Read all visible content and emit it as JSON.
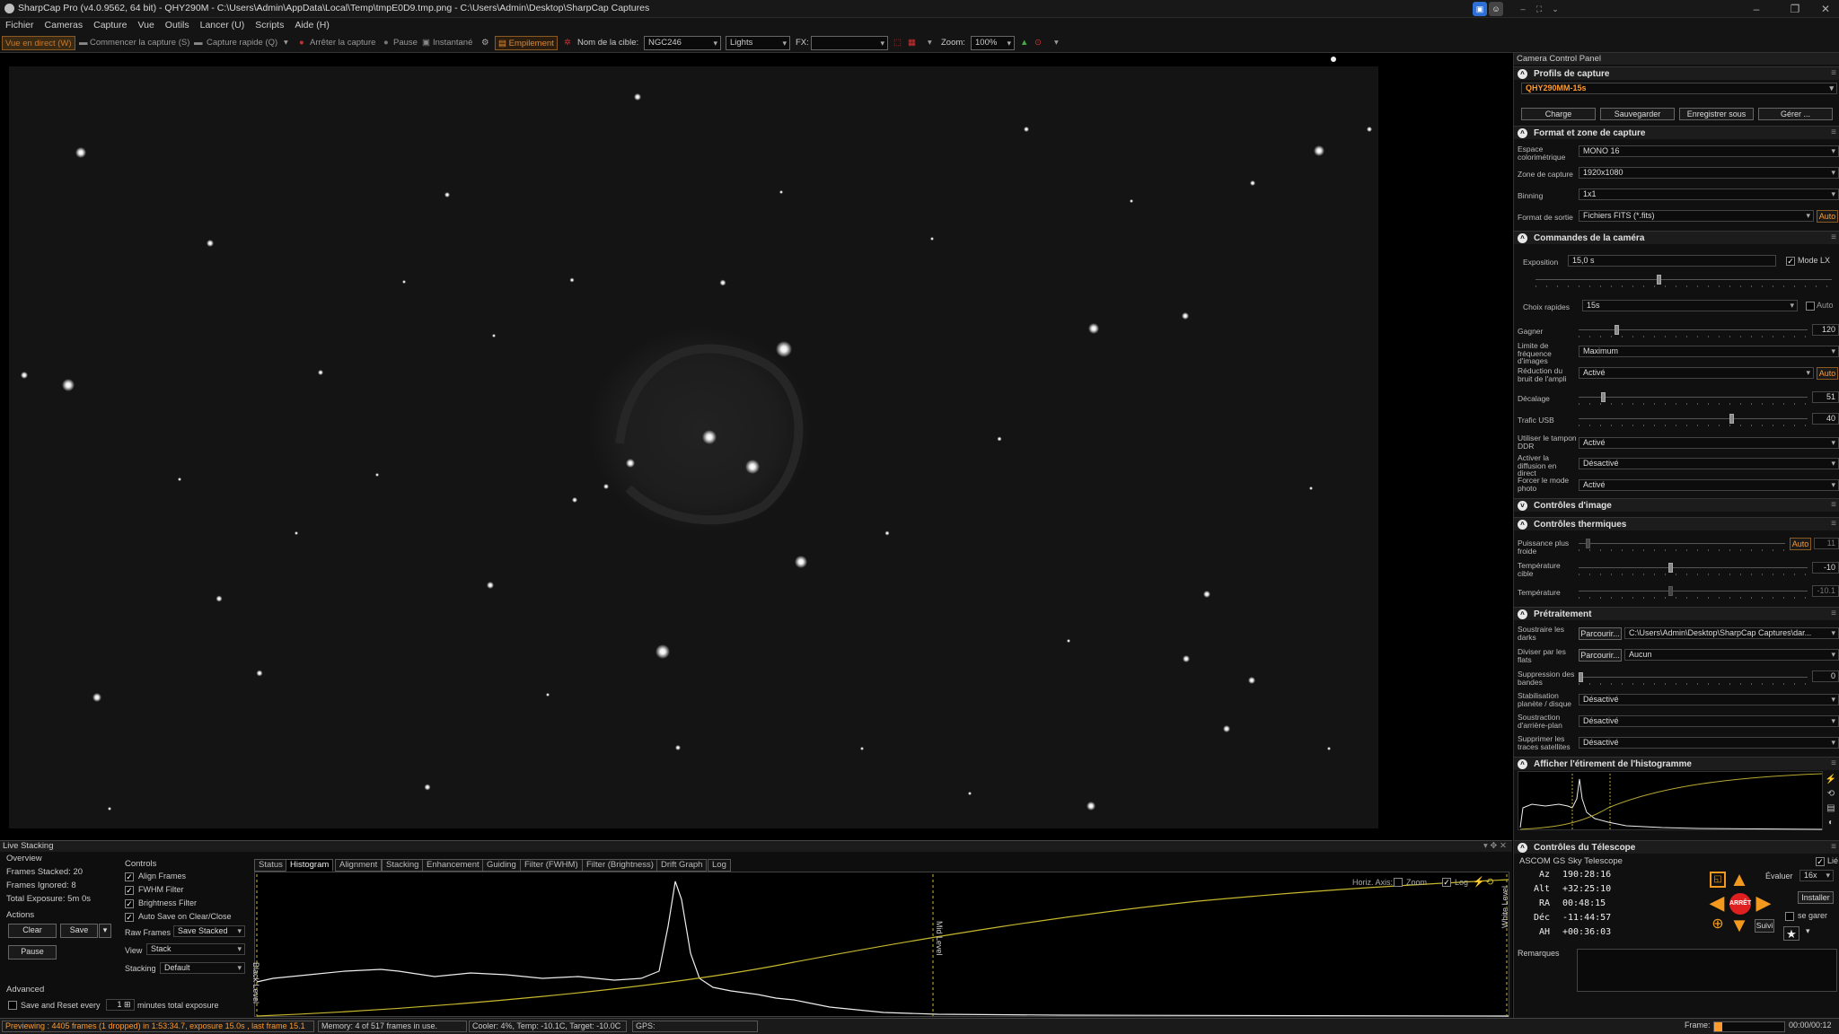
{
  "titlebar": {
    "title": "SharpCap Pro (v4.0.9562, 64 bit) - QHY290M - C:\\Users\\Admin\\AppData\\Local\\Temp\\tmpE0D9.tmp.png - C:\\Users\\Admin\\Desktop\\SharpCap Captures"
  },
  "menu": [
    "Fichier",
    "Cameras",
    "Capture",
    "Vue",
    "Outils",
    "Lancer (U)",
    "Scripts",
    "Aide (H)"
  ],
  "toolbar": {
    "live": "Vue en direct (W)",
    "start": "Commencer la capture (S)",
    "quick": "Capture rapide (Q)",
    "stop": "Arrêter la capture",
    "pause": "Pause",
    "snapshot": "Instantané",
    "stack": "Empilement",
    "target_label": "Nom de la cible:",
    "target": "NGC246",
    "frame_type": "Lights",
    "fx_label": "FX:",
    "fx": "",
    "zoom_label": "Zoom:",
    "zoom": "100%"
  },
  "panel": {
    "title": "Camera Control Panel",
    "s_profiles": "Profils de capture",
    "profile": "QHY290MM-15s",
    "btn_load": "Charge",
    "btn_save": "Sauvegarder",
    "btn_saveas": "Enregistrer sous",
    "btn_manage": "Gérer ...",
    "s_format": "Format et zone de capture",
    "color_space_l": "Espace colorimétrique",
    "color_space": "MONO 16",
    "roi_l": "Zone de capture",
    "roi": "1920x1080",
    "binning_l": "Binning",
    "binning": "1x1",
    "out_l": "Format de sortie",
    "out": "Fichiers FITS (*.fits)",
    "auto": "Auto",
    "s_cam": "Commandes de la caméra",
    "exp_l": "Exposition",
    "exp": "15,0 s",
    "lx": "Mode LX",
    "quick_l": "Choix rapides",
    "quick": "15s",
    "auto2": "Auto",
    "gain_l": "Gagner",
    "gain": "120",
    "fps_l": "Limite de fréquence d'images",
    "fps": "Maximum",
    "nr_l": "Réduction du bruit de l'ampli",
    "nr": "Activé",
    "offset_l": "Décalage",
    "offset": "51",
    "usb_l": "Trafic USB",
    "usb": "40",
    "ddr_l": "Utiliser le tampon DDR",
    "ddr": "Activé",
    "stream_l": "Activer la diffusion en direct",
    "stream": "Désactivé",
    "photo_l": "Forcer le mode photo",
    "photo": "Activé",
    "s_img": "Contrôles d'image",
    "s_therm": "Contrôles thermiques",
    "cooler_l": "Puissance plus froide",
    "cooler": "11",
    "target_t_l": "Température cible",
    "target_t": "-10",
    "temp_l": "Température",
    "temp": "-10.1",
    "s_pre": "Prétraitement",
    "dark_l": "Soustraire les darks",
    "browse": "Parcourir...",
    "dark": "C:\\Users\\Admin\\Desktop\\SharpCap Captures\\dar...",
    "flat_l": "Diviser par les flats",
    "flat": "Aucun",
    "band_l": "Suppression des bandes",
    "band": "0",
    "stab_l": "Stabilisation planète / disque",
    "stab": "Désactivé",
    "bg_l": "Soustraction d'arrière-plan",
    "bg": "Désactivé",
    "sat_l": "Supprimer les traces satellites",
    "sat": "Désactivé",
    "s_hist": "Afficher l'étirement de l'histogramme",
    "s_tel": "Contrôles du Télescope",
    "scope": "ASCOM GS Sky Telescope",
    "linked": "Lié",
    "az_l": "Az",
    "az": "190:28:16",
    "alt_l": "Alt",
    "alt": "+32:25:10",
    "ra_l": "RA",
    "ra": "00:48:15",
    "dec_l": "Déc",
    "dec": "-11:44:57",
    "ah_l": "AH",
    "ah": "+00:36:03",
    "rate_l": "Évaluer",
    "rate": "16x",
    "install": "Installer",
    "park": "se garer",
    "stop": "ARRÊT",
    "track": "Suivi",
    "notes": "Remarques"
  },
  "ls": {
    "title": "Live Stacking",
    "overview": "Overview",
    "stacked": "Frames Stacked: 20",
    "ignored": "Frames Ignored: 8",
    "total": "Total Exposure:   5m 0s",
    "actions": "Actions",
    "clear": "Clear",
    "save": "Save",
    "pause": "Pause",
    "advanced": "Advanced",
    "save_reset": "Save and Reset every",
    "minutes": "minutes total exposure",
    "controls": "Controls",
    "align": "Align Frames",
    "fwhm": "FWHM Filter",
    "bright": "Brightness Filter",
    "autosave": "Auto Save on Clear/Close",
    "raw_l": "Raw Frames",
    "raw": "Save Stacked",
    "view_l": "View",
    "view": "Stack",
    "stacking_l": "Stacking",
    "stacking": "Default",
    "tabs": [
      "Status",
      "Histogram",
      "Alignment",
      "Stacking",
      "Enhancement",
      "Guiding",
      "Filter (FWHM)",
      "Filter (Brightness)",
      "Drift Graph",
      "Log"
    ],
    "horiz": "Horiz. Axis:",
    "zoom": "Zoom",
    "log": "Log",
    "black": "Black Level",
    "mid": "Mid Level",
    "white": "White Level"
  },
  "status": {
    "preview": "Previewing : 4405 frames (1 dropped) in 1:53:34.7, exposure 15.0s , last frame 15.1",
    "memory": "Memory: 4 of 517 frames in use.",
    "cooler": "Cooler: 4%, Temp: -10.1C, Target: -10.0C",
    "gps": "GPS:",
    "frame_l": "Frame:",
    "frame": "00:00/00:12"
  }
}
